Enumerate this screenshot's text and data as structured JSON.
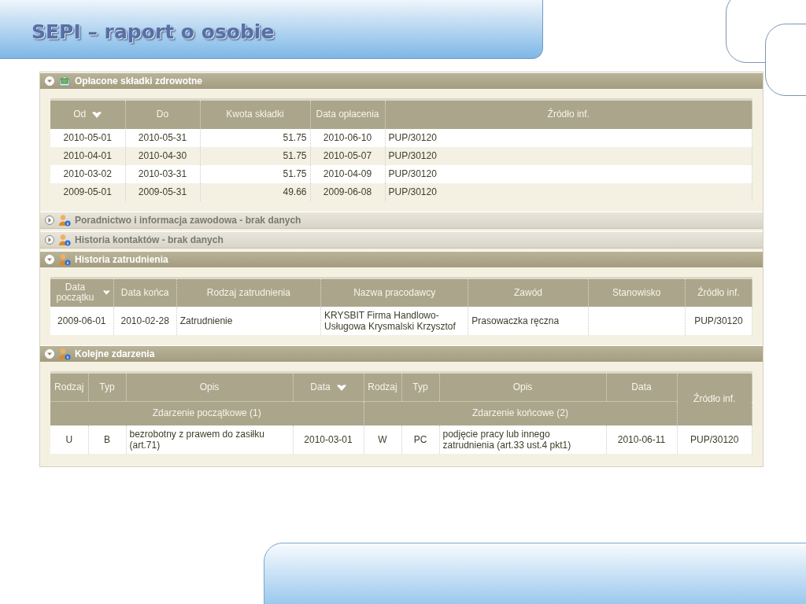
{
  "title": "SEPI – raport o osobie",
  "sections": [
    {
      "title": "Opłacone składki zdrowotne",
      "expanded": true,
      "kind": "table",
      "columns": [
        {
          "label": "Od",
          "sorted": true
        },
        {
          "label": "Do",
          "sorted": false
        },
        {
          "label": "Kwota składki",
          "sorted": false
        },
        {
          "label": "Data opłacenia",
          "sorted": false
        },
        {
          "label": "Źródło inf.",
          "sorted": false
        }
      ],
      "rows": [
        [
          "2010-05-01",
          "2010-05-31",
          "51.75",
          "2010-06-10",
          "PUP/30120"
        ],
        [
          "2010-04-01",
          "2010-04-30",
          "51.75",
          "2010-05-07",
          "PUP/30120"
        ],
        [
          "2010-03-02",
          "2010-03-31",
          "51.75",
          "2010-04-09",
          "PUP/30120"
        ],
        [
          "2009-05-01",
          "2009-05-31",
          "49.66",
          "2009-06-08",
          "PUP/30120"
        ]
      ]
    },
    {
      "title": "Poradnictwo i informacja zawodowa - brak danych",
      "expanded": false
    },
    {
      "title": "Historia kontaktów - brak danych",
      "expanded": false
    },
    {
      "title": "Historia zatrudnienia",
      "expanded": true,
      "kind": "table",
      "columns": [
        {
          "label": "Data początku",
          "sorted": true
        },
        {
          "label": "Data końca",
          "sorted": false
        },
        {
          "label": "Rodzaj zatrudnienia",
          "sorted": false
        },
        {
          "label": "Nazwa pracodawcy",
          "sorted": false
        },
        {
          "label": "Zawód",
          "sorted": false
        },
        {
          "label": "Stanowisko",
          "sorted": false
        },
        {
          "label": "Źródło inf.",
          "sorted": false
        }
      ],
      "rows": [
        [
          "2009-06-01",
          "2010-02-28",
          "Zatrudnienie",
          "KRYSBIT Firma Handlowo-Usługowa Krysmalski Krzysztof",
          "Prasowaczka ręczna",
          "",
          "PUP/30120"
        ]
      ]
    },
    {
      "title": "Kolejne zdarzenia",
      "expanded": true,
      "kind": "events",
      "groups": [
        {
          "label": "Zdarzenie początkowe (1)",
          "columns": [
            {
              "label": "Rodzaj",
              "sorted": false
            },
            {
              "label": "Typ",
              "sorted": false
            },
            {
              "label": "Opis",
              "sorted": false
            },
            {
              "label": "Data",
              "sorted": true
            }
          ]
        },
        {
          "label": "Zdarzenie końcowe (2)",
          "columns": [
            {
              "label": "Rodzaj",
              "sorted": false
            },
            {
              "label": "Typ",
              "sorted": false
            },
            {
              "label": "Opis",
              "sorted": false
            },
            {
              "label": "Data",
              "sorted": false
            }
          ]
        }
      ],
      "source_column": "Źródło inf.",
      "rows": [
        [
          "U",
          "B",
          "bezrobotny z prawem do zasiłku (art.71)",
          "2010-03-01",
          "W",
          "PC",
          "podjęcie pracy lub innego zatrudnienia (art.33 ust.4 pkt1)",
          "2010-06-11",
          "PUP/30120"
        ]
      ]
    }
  ]
}
